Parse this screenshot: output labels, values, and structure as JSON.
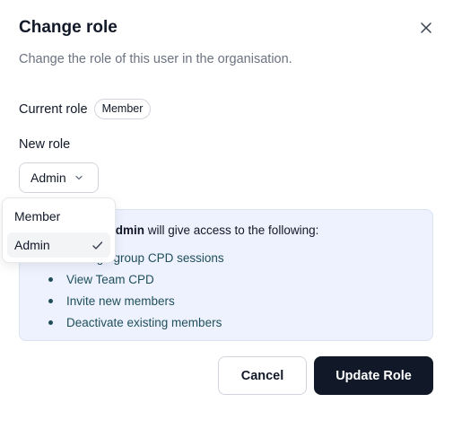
{
  "dialog": {
    "title": "Change role",
    "subtitle": "Change the role of this user in the organisation."
  },
  "current_role": {
    "label": "Current role",
    "value": "Member"
  },
  "new_role": {
    "label": "New role",
    "selected": "Admin",
    "options": [
      "Member",
      "Admin"
    ]
  },
  "info": {
    "role_name": "Admin",
    "intro_suffix": " will give access to the following:",
    "permissions": [
      "Manage group CPD sessions",
      "View Team CPD",
      "Invite new members",
      "Deactivate existing members"
    ]
  },
  "buttons": {
    "cancel": "Cancel",
    "update": "Update Role"
  },
  "colors": {
    "primary": "#111827",
    "info_bg": "#eef2ff",
    "permission_text": "#1f4f5a",
    "muted_text": "#6b7280"
  },
  "icons": {
    "close": "close-icon",
    "select": "chevron-down-icon",
    "selected_option": "check-icon"
  }
}
